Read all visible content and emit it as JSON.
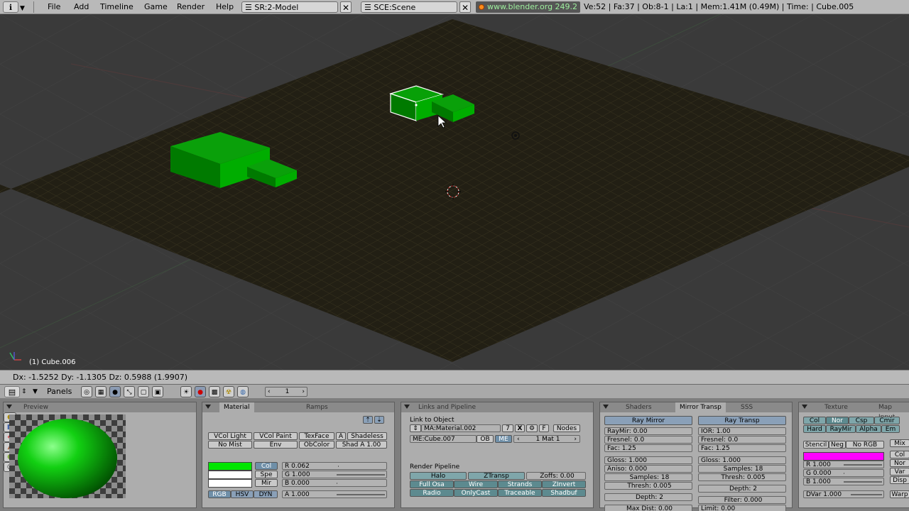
{
  "header": {
    "menus": [
      "File",
      "Add",
      "Timeline",
      "Game",
      "Render",
      "Help"
    ],
    "screen": "SR:2-Model",
    "scene": "SCE:Scene",
    "url": "www.blender.org 249.2",
    "stats": "Ve:52 | Fa:37 | Ob:8-1 | La:1  | Mem:1.41M (0.49M)  | Time: | Cube.005"
  },
  "viewport": {
    "object_label": "(1) Cube.006",
    "status": "Dx: -1.5252   Dy: -1.1305  Dz: 0.5988 (1.9907)"
  },
  "buttons_header": {
    "panels_label": "Panels",
    "frame": "1"
  },
  "preview": {
    "tab": "Preview"
  },
  "material": {
    "tabs": [
      "Material",
      "Ramps"
    ],
    "row1": [
      "VCol Light",
      "VCol Paint",
      "TexFace",
      "A",
      "Shadeless"
    ],
    "row2": [
      "No Mist",
      "Env",
      "ObColor",
      "Shad A 1.00"
    ],
    "color_buttons": [
      "Col",
      "Spe",
      "Mir"
    ],
    "r": "R 0.062",
    "g": "G 1.000",
    "b": "B 0.000",
    "modes": [
      "RGB",
      "HSV",
      "DYN"
    ],
    "alpha": "A 1.000",
    "col_hex": "#00e600",
    "spe_hex": "#ffffff",
    "mir_hex": "#ffffff"
  },
  "links": {
    "tabs": [
      "Links and Pipeline"
    ],
    "link_to_object": "Link to Object",
    "material_name": "MA:Material.002",
    "users": "7",
    "x": "X",
    "f": "F",
    "nodes": "Nodes",
    "mesh": "ME:Cube.007",
    "ob": "OB",
    "me": "ME",
    "mat": "1 Mat 1",
    "render_pipeline": "Render Pipeline",
    "pipe_row1": [
      "Halo",
      "ZTransp",
      "Zoffs: 0.00"
    ],
    "pipe_row2": [
      "Full Osa",
      "Wire",
      "Strands",
      "ZInvert"
    ],
    "pipe_row3": [
      "Radio",
      "OnlyCast",
      "Traceable",
      "Shadbuf"
    ]
  },
  "mirror": {
    "tabs": [
      "Shaders",
      "Mirror Transp",
      "SSS"
    ],
    "ray_mirror": "Ray Mirror",
    "ray_transp": "Ray Transp",
    "left": [
      "RayMir: 0.00",
      "Fresnel: 0.0",
      "Fac: 1.25",
      "Gloss: 1.000",
      "Aniso: 0.000",
      "Samples: 18",
      "Thresh: 0.005",
      "Depth: 2",
      "Max Dist: 0.00"
    ],
    "right": [
      "IOR: 1.00",
      "Fresnel: 0.0",
      "Fac: 1.25",
      "Gloss: 1.000",
      "Samples: 18",
      "Thresh: 0.005",
      "Depth: 2",
      "Filter: 0.000",
      "Limit: 0.00"
    ]
  },
  "texture": {
    "tabs": [
      "Texture",
      "Map Input"
    ],
    "row1": [
      "Col",
      "Nor",
      "Csp",
      "Cmir"
    ],
    "row2": [
      "Hard",
      "RayMir",
      "Alpha",
      "Em"
    ],
    "row3": [
      "Stencil",
      "Neg",
      "No RGB"
    ],
    "r": "R 1.000",
    "g": "G 0.000",
    "b": "B 1.000",
    "dvar": "DVar 1.000",
    "side": [
      "Mix",
      "Col",
      "Nor",
      "Var",
      "Disp",
      "Warp"
    ],
    "tex_hex": "#ff00ff"
  }
}
